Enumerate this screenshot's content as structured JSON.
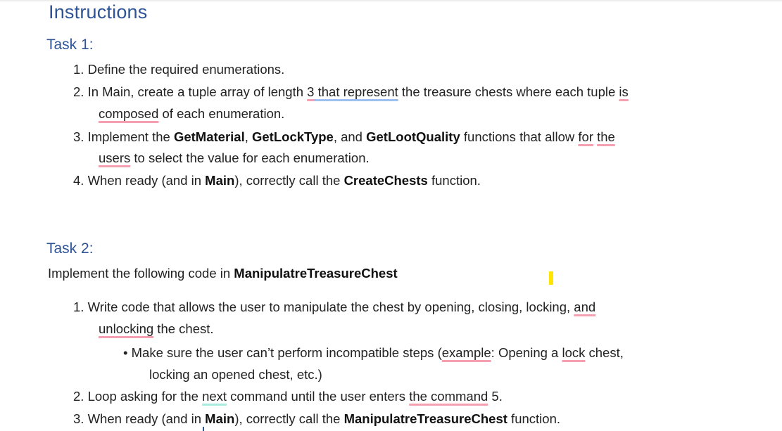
{
  "document": {
    "title": "Instructions",
    "task1": {
      "heading": "Task 1:",
      "items": [
        {
          "num": "1.",
          "text": "Define the required enumerations."
        },
        {
          "num": "2.",
          "parts": [
            "In Main, create a tuple array of length ",
            "3",
            " ",
            "that represent",
            " the treasure chests where each tuple ",
            "is"
          ],
          "cont_parts": [
            "composed",
            " of each enumeration."
          ]
        },
        {
          "num": "3.",
          "parts": [
            "Implement the ",
            "GetMaterial",
            ", ",
            "GetLockType",
            ", and ",
            "GetLootQuality",
            " functions that allow ",
            "for",
            " ",
            "the"
          ],
          "cont_parts": [
            "users",
            " to select the value for each enumeration."
          ]
        },
        {
          "num": "4.",
          "parts": [
            "When ready (and in ",
            "Main",
            "), correctly call the ",
            "CreateChests",
            " function."
          ]
        }
      ]
    },
    "task2": {
      "heading": "Task 2:",
      "intro": [
        "Implement the following code in ",
        "ManipulatreTreasureChest"
      ],
      "items": [
        {
          "num": "1.",
          "parts": [
            "Write code that allows the user to manipulate the chest by opening, closing, locking, ",
            "and"
          ],
          "cont_parts": [
            "unlocking",
            " the chest."
          ],
          "bullet": {
            "symbol": "•",
            "parts": [
              "Make sure the user can’t perform incompatible steps (",
              "example",
              ": Opening a ",
              "lock",
              " chest,"
            ],
            "cont": "locking an opened chest, etc.)"
          }
        },
        {
          "num": "2.",
          "parts": [
            "Loop asking for the ",
            "next",
            " command until the user enters ",
            "the command",
            " 5."
          ]
        },
        {
          "num": "3.",
          "parts": [
            "When ready (and in ",
            "Main",
            "), correctly call the ",
            "ManipulatreTreasureChest",
            " function."
          ]
        }
      ]
    }
  }
}
